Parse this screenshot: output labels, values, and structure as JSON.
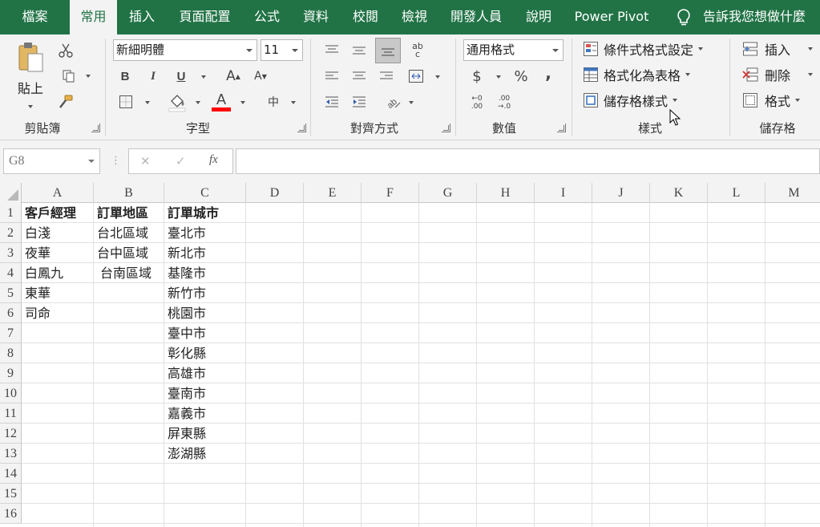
{
  "tabs": [
    "檔案",
    "常用",
    "插入",
    "頁面配置",
    "公式",
    "資料",
    "校閱",
    "檢視",
    "開發人員",
    "說明",
    "Power Pivot"
  ],
  "active_tab": "常用",
  "tell_me": "告訴我您想做什麼",
  "clipboard": {
    "paste": "貼上",
    "label": "剪貼簿"
  },
  "font": {
    "name": "新細明體",
    "size": "11",
    "label": "字型",
    "bold": "B",
    "italic": "I",
    "underline": "U",
    "font_color_letter": "A",
    "font_color": "#ff0000",
    "increase": "A",
    "decrease": "A",
    "phonetic": "中"
  },
  "alignment": {
    "label": "對齊方式",
    "wrap_top": "ab",
    "wrap_bottom": "c"
  },
  "number": {
    "format": "通用格式",
    "label": "數值",
    "currency": "$",
    "percent": "%",
    "comma": ",",
    "inc_decimal_top": "←0",
    "inc_decimal_bottom": ".00",
    "dec_decimal_top": ".00",
    "dec_decimal_bottom": "→.0"
  },
  "styles": {
    "items": [
      "條件式格式設定",
      "格式化為表格",
      "儲存格樣式"
    ],
    "label": "樣式"
  },
  "cells": {
    "items": [
      "插入",
      "刪除",
      "格式"
    ],
    "label": "儲存格"
  },
  "formula_bar": {
    "name_box": "G8",
    "cancel": "✕",
    "enter": "✓",
    "fx": "fx",
    "content": ""
  },
  "columns": [
    "A",
    "B",
    "C",
    "D",
    "E",
    "F",
    "G",
    "H",
    "I",
    "J",
    "K",
    "L",
    "M"
  ],
  "rows": [
    "1",
    "2",
    "3",
    "4",
    "5",
    "6",
    "7",
    "8",
    "9",
    "10",
    "11",
    "12",
    "13",
    "14",
    "15",
    "16"
  ],
  "colA": [
    "客戶經理",
    "白淺",
    "夜華",
    "白鳳九",
    "東華",
    "司命"
  ],
  "colB": [
    "訂單地區",
    "台北區域",
    "台中區域",
    "台南區域"
  ],
  "colC": [
    "訂單城市",
    "臺北市",
    "新北市",
    "基隆市",
    "新竹市",
    "桃園市",
    "臺中市",
    "彰化縣",
    "高雄市",
    "臺南市",
    "嘉義市",
    "屏東縣",
    "澎湖縣"
  ],
  "accent": "#217346"
}
